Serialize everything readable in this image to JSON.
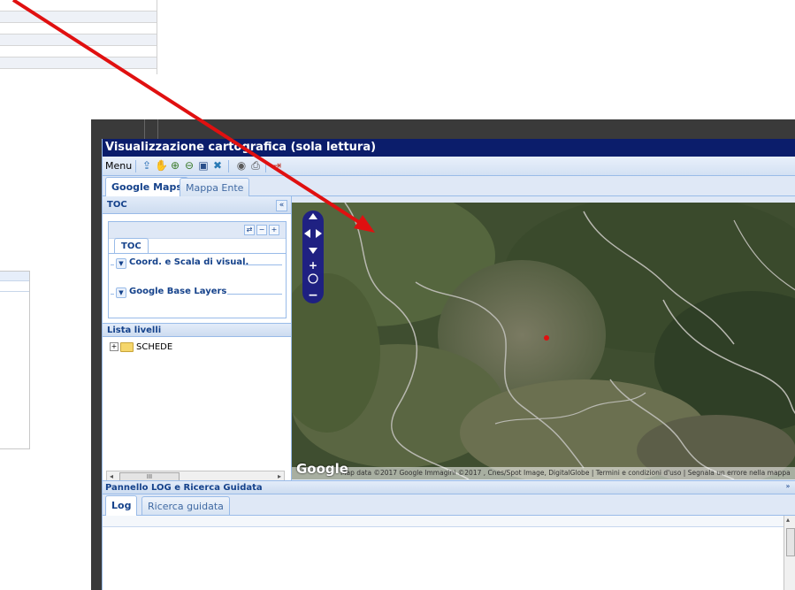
{
  "window": {
    "title": "Visualizzazione cartografica (sola lettura)"
  },
  "toolbar": {
    "menu_label": "Menu",
    "icons": [
      "export-icon",
      "pan-hand-icon",
      "zoom-in-icon",
      "zoom-out-icon",
      "zoom-box-icon",
      "full-extent-icon",
      "identify-icon",
      "print-icon",
      "exit-icon"
    ]
  },
  "main_tabs": [
    {
      "label": "Google Maps",
      "active": true
    },
    {
      "label": "Mappa Ente",
      "active": false
    }
  ],
  "toc": {
    "header": "TOC",
    "inner_tab": "TOC",
    "fieldsets": [
      {
        "label": "Coord. e Scala di visual."
      },
      {
        "label": "Google Base Layers"
      }
    ],
    "list_header": "Lista livelli",
    "tree_items": [
      {
        "label": "SCHEDE",
        "expandable": true
      }
    ],
    "scrollbar_thumb": "III"
  },
  "map": {
    "logo": "Google",
    "attribution": "Map data ©2017 Google Immagini ©2017 , Cnes/Spot Image, DigitalGlobe  |  Termini e condizioni d'uso  |  Segnala un errore nella mappa"
  },
  "log_panel": {
    "header": "Pannello LOG e Ricerca Guidata",
    "tabs": [
      {
        "label": "Log",
        "active": true
      },
      {
        "label": "Ricerca guidata",
        "active": false
      }
    ]
  },
  "colors": {
    "title_bar": "#0b1d6b",
    "panel_header_text": "#15428b",
    "annotation_arrow": "#e01010"
  }
}
